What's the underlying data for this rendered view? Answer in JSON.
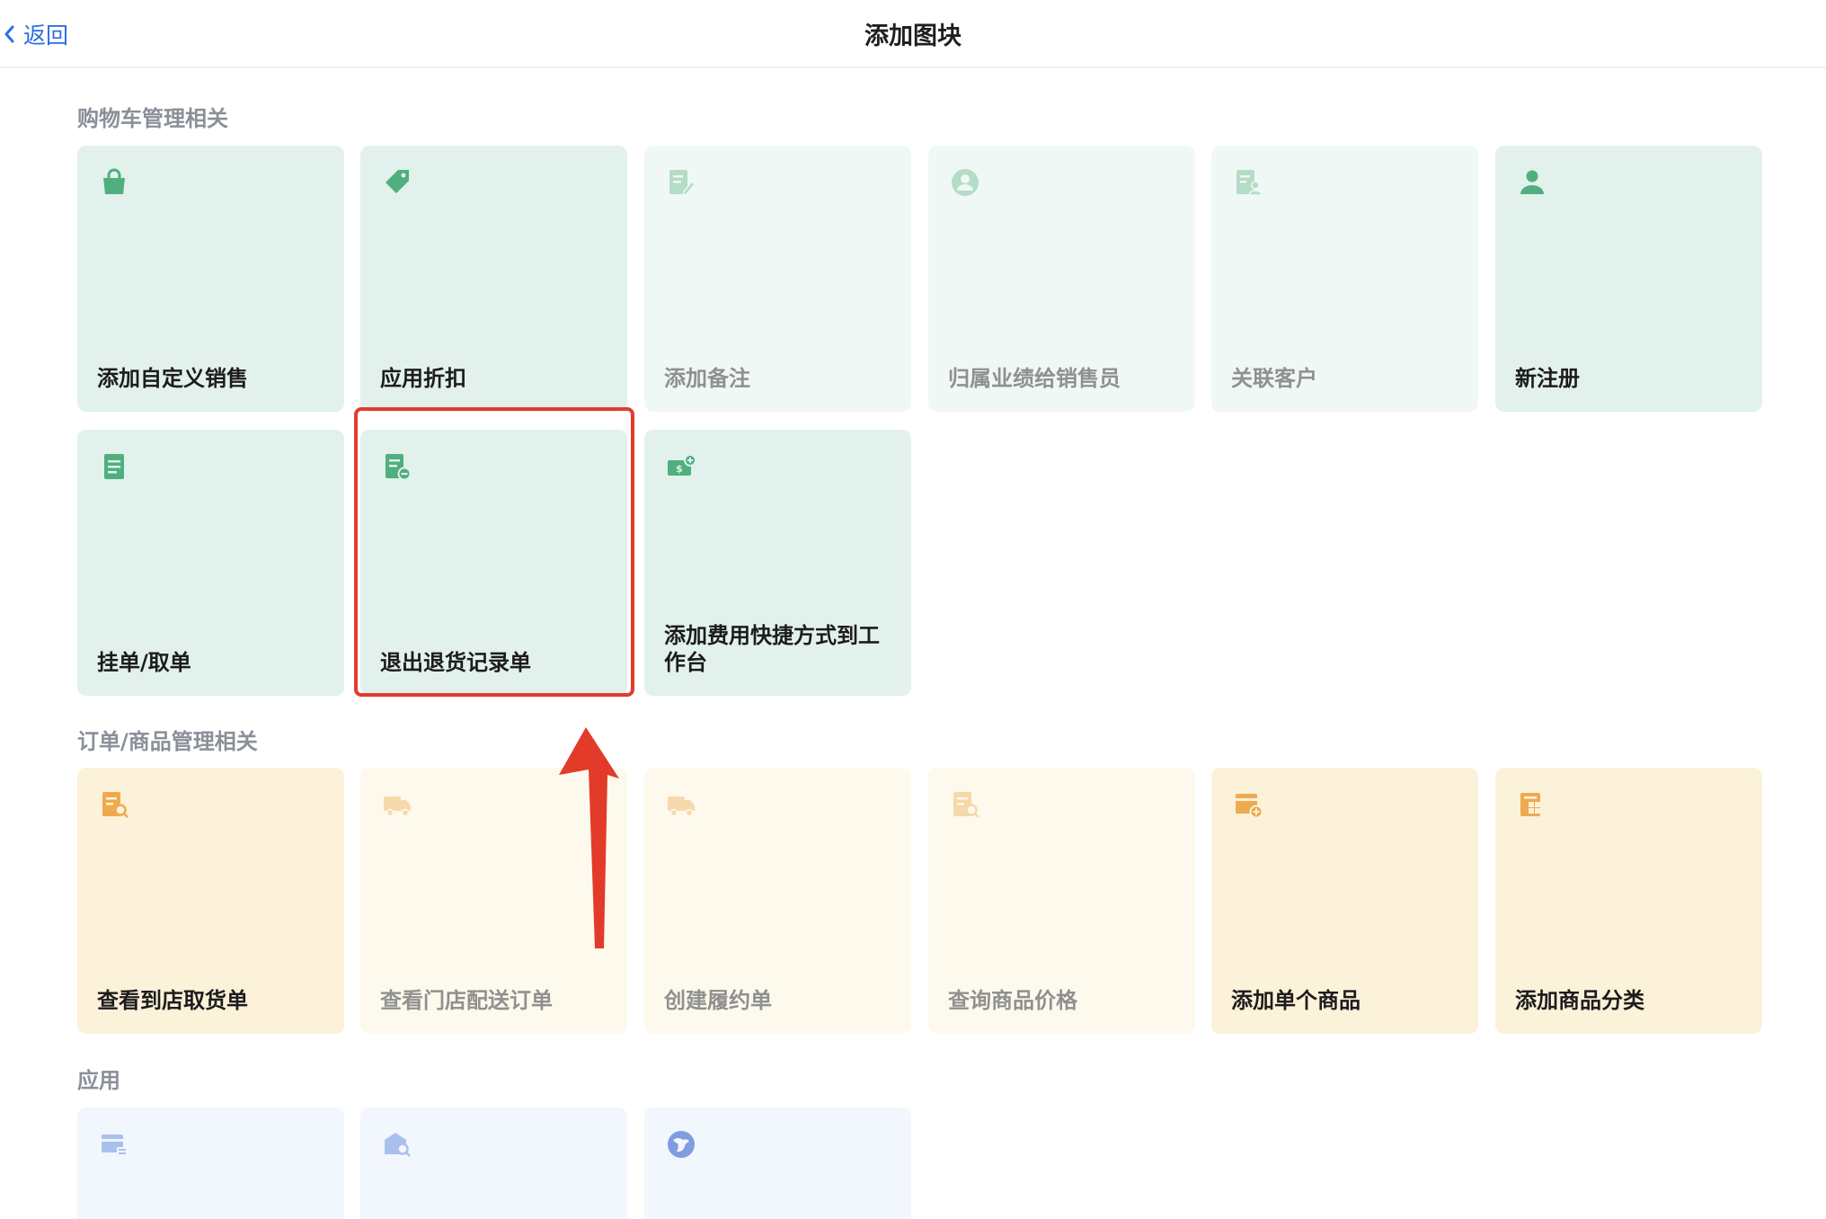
{
  "header": {
    "back_label": "返回",
    "title": "添加图块"
  },
  "sections": {
    "cart": {
      "title": "购物车管理相关"
    },
    "order": {
      "title": "订单/商品管理相关"
    },
    "apps": {
      "title": "应用"
    }
  },
  "tiles": {
    "add_custom_sale": {
      "label": "添加自定义销售",
      "icon": "shopping-bag-icon"
    },
    "apply_discount": {
      "label": "应用折扣",
      "icon": "tag-icon"
    },
    "add_note": {
      "label": "添加备注",
      "icon": "note-edit-icon"
    },
    "assign_salesperson": {
      "label": "归属业绩给销售员",
      "icon": "person-circle-icon"
    },
    "link_customer": {
      "label": "关联客户",
      "icon": "document-person-icon"
    },
    "new_register": {
      "label": "新注册",
      "icon": "person-icon"
    },
    "hold_order": {
      "label": "挂单/取单",
      "icon": "document-list-icon"
    },
    "exit_return": {
      "label": "退出退货记录单",
      "icon": "document-minus-icon"
    },
    "add_fee_shortcut": {
      "label": "添加费用快捷方式到工作台",
      "icon": "cash-plus-icon"
    },
    "pickup_orders": {
      "label": "查看到店取货单",
      "icon": "document-search-icon"
    },
    "delivery_orders": {
      "label": "查看门店配送订单",
      "icon": "truck-icon"
    },
    "create_fulfillment": {
      "label": "创建履约单",
      "icon": "truck-icon"
    },
    "query_price": {
      "label": "查询商品价格",
      "icon": "document-search-icon"
    },
    "add_product": {
      "label": "添加单个商品",
      "icon": "card-plus-icon"
    },
    "add_category": {
      "label": "添加商品分类",
      "icon": "grid-document-icon"
    },
    "app_1": {
      "icon": "card-list-icon"
    },
    "app_2": {
      "icon": "store-search-icon"
    },
    "app_3": {
      "icon": "bird-icon"
    }
  },
  "colors": {
    "green_icon": "#4faf7e",
    "green_icon_faded": "#b4dcc6",
    "yellow_icon": "#eeaa4f",
    "yellow_icon_faded": "#f6d9a8",
    "blue_icon_faded": "#a9c0ef",
    "accent_link": "#2c6fe0",
    "annotation_red": "#e33b2a"
  }
}
